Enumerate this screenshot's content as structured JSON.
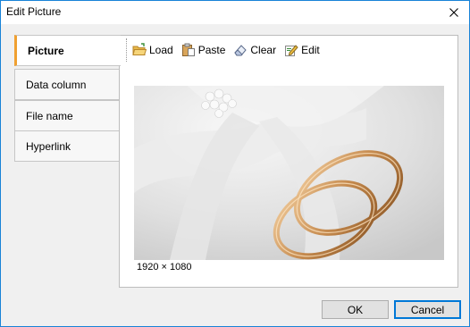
{
  "window": {
    "title": "Edit Picture"
  },
  "tabs": [
    {
      "label": "Picture",
      "active": true
    },
    {
      "label": "Data column",
      "active": false
    },
    {
      "label": "File name",
      "active": false
    },
    {
      "label": "Hyperlink",
      "active": false
    }
  ],
  "toolbar": {
    "load_label": "Load",
    "paste_label": "Paste",
    "clear_label": "Clear",
    "edit_label": "Edit"
  },
  "picture": {
    "dimensions": "1920 × 1080"
  },
  "buttons": {
    "ok_label": "OK",
    "cancel_label": "Cancel"
  },
  "colors": {
    "accent_tab": "#f0a030",
    "window_border": "#1883d7",
    "default_button_border": "#0078d7"
  }
}
